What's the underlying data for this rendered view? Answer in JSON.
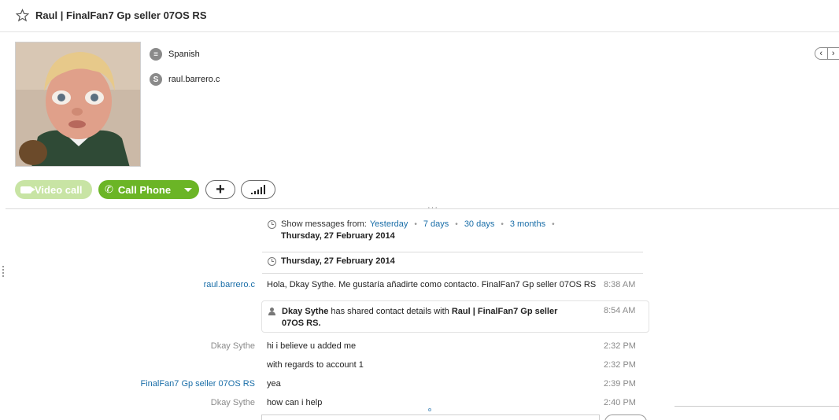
{
  "header": {
    "title": "Raul | FinalFan7 Gp seller 07OS RS"
  },
  "profile": {
    "language": "Spanish",
    "skype_name": "raul.barrero.c"
  },
  "actions": {
    "video_call_label": "Video call",
    "call_phone_label": "Call Phone"
  },
  "colors": {
    "call_green": "#6bb526",
    "video_green_disabled": "#c8e4a4",
    "link_blue": "#1a6ea8"
  },
  "history": {
    "show_label": "Show messages from:",
    "options": [
      "Yesterday",
      "7 days",
      "30 days",
      "3 months"
    ],
    "current_date": "Thursday, 27 February 2014"
  },
  "conversation": {
    "date_header": "Thursday, 27 February 2014",
    "messages": [
      {
        "sender": "raul.barrero.c",
        "text": "Hola, Dkay Sythe. Me gustaría añadirte como contacto. FinalFan7 Gp seller 07OS RS",
        "time": "8:38 AM"
      },
      {
        "sender": "Dkay Sythe",
        "text": "hi i believe u added me",
        "time": "2:32 PM"
      },
      {
        "sender": "",
        "text": "with regards to account 1",
        "time": "2:32 PM"
      },
      {
        "sender": "FinalFan7 Gp seller 07OS RS",
        "text": "yea",
        "time": "2:39 PM"
      },
      {
        "sender": "Dkay Sythe",
        "text": "how can i help",
        "time": "2:40 PM"
      }
    ],
    "shared": {
      "from": "Dkay Sythe",
      "middle": "has shared contact details with",
      "to": "Raul | FinalFan7 Gp seller 07OS RS",
      "period": ".",
      "time": "8:54 AM"
    }
  }
}
